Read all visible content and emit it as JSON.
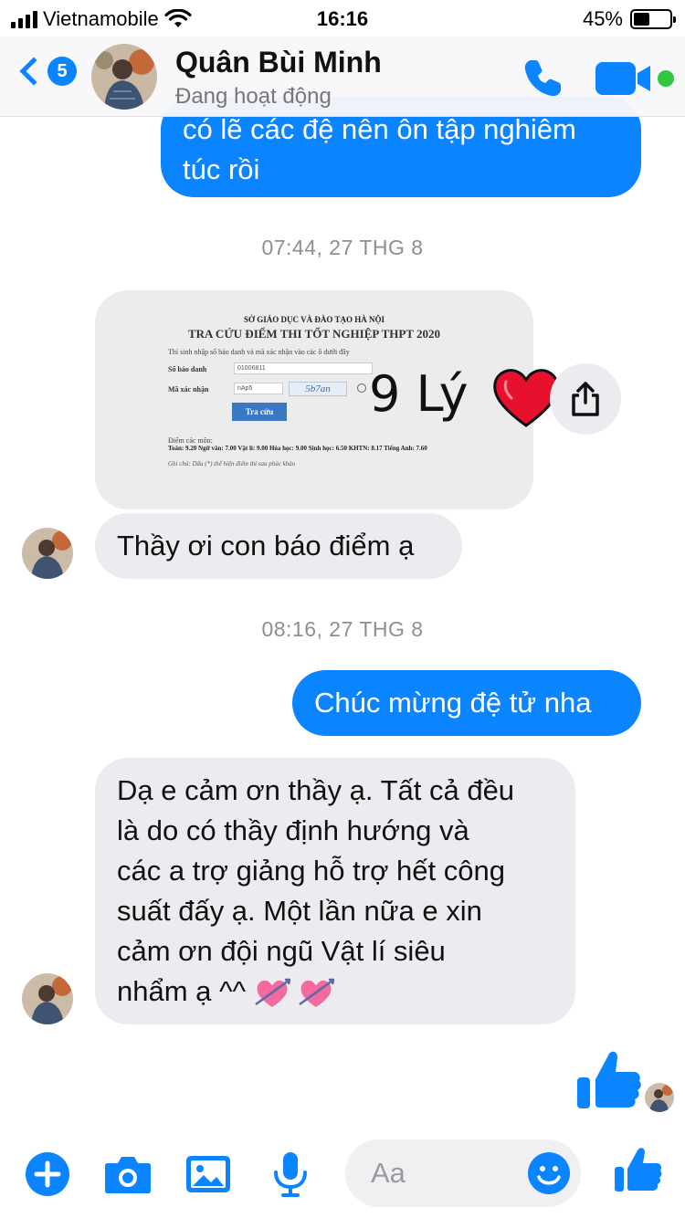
{
  "status_bar": {
    "carrier": "Vietnamobile",
    "time": "16:16",
    "battery": "45%",
    "battery_level": 0.45
  },
  "header": {
    "back_count": "5",
    "contact_name": "Quân Bùi Minh",
    "contact_status": "Đang hoạt động",
    "online_color": "#31c73f"
  },
  "messages": {
    "outgoing_1_line_1": "có lẽ các đệ nên ôn tập nghiêm",
    "outgoing_1_line_2": "túc rồi",
    "timestamp_1": "07:44, 27 THG 8",
    "incoming_1": "Thầy ơi con báo điểm ạ",
    "timestamp_2": "08:16, 27 THG 8",
    "outgoing_2": "Chúc mừng đệ tử nha",
    "incoming_2_lines": [
      "Dạ e cảm ơn thầy ạ. Tất cả đều",
      "là do có thầy định hướng và",
      "các a trợ giảng hỗ trợ hết công",
      "suất đấy ạ. Một lần nữa e xin",
      "cảm ơn đội ngũ Vật lí siêu",
      "nhẩm ạ ^^"
    ]
  },
  "score_card": {
    "department": "SỞ GIÁO DỤC VÀ ĐÀO TẠO HÀ NỘI",
    "title": "TRA CỨU ĐIỂM THI TỐT NGHIỆP THPT 2020",
    "instruction": "Thí sinh nhập số báo danh và mã xác nhận vào các ô dưới đây",
    "id_label": "Số báo danh",
    "id_value": "01006811",
    "captcha_label": "Mã xác nhận",
    "captcha_input": "nAp5",
    "captcha_image": "5b7an",
    "button": "Tra cứu",
    "scores_label": "Điểm các môn:",
    "scores": "Toán: 9.20  Ngữ văn: 7.00  Vật lí: 9.00  Hóa học: 9.00  Sinh học: 6.50  KHTN: 8.17  Tiếng Anh: 7.60",
    "note": "Ghi chú: Dấu (*) thể hiện điểm thi sau phúc khảo",
    "handwritten": "9 Lý"
  },
  "composer": {
    "placeholder": "Aa"
  },
  "colors": {
    "accent": "#0a84ff",
    "incoming_bubble": "#ececf0",
    "heart": "#e8112d"
  },
  "icons": [
    "signal-icon",
    "wifi-icon",
    "battery-icon",
    "back-chevron-icon",
    "phone-icon",
    "video-camera-icon",
    "heart-icon",
    "share-icon",
    "heart-arrow-emoji-icon",
    "thumbs-up-icon",
    "plus-icon",
    "camera-icon",
    "image-icon",
    "microphone-icon",
    "smiley-icon"
  ]
}
